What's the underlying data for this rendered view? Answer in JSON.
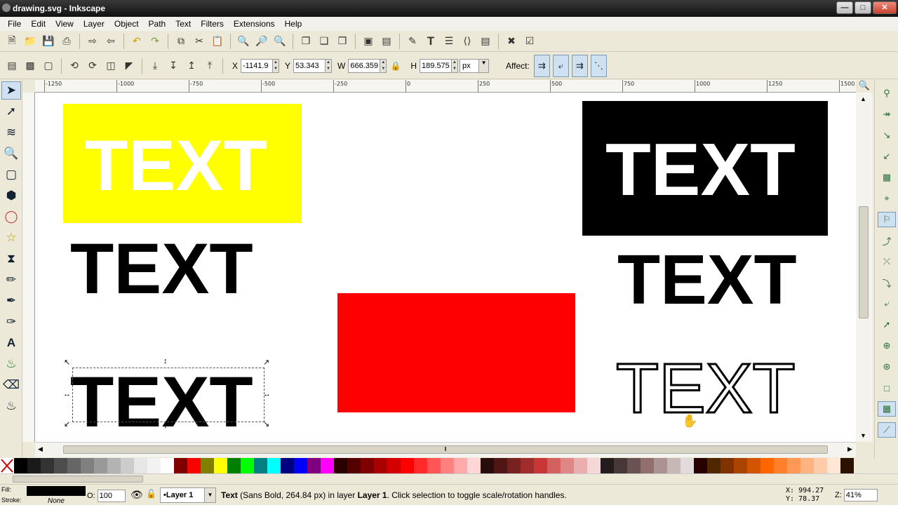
{
  "window": {
    "title": "drawing.svg - Inkscape"
  },
  "menus": [
    "File",
    "Edit",
    "View",
    "Layer",
    "Object",
    "Path",
    "Text",
    "Filters",
    "Extensions",
    "Help"
  ],
  "controls": {
    "x_label": "X",
    "x_value": "-1141.9",
    "y_label": "Y",
    "y_value": "53.343",
    "w_label": "W",
    "w_value": "666.359",
    "h_label": "H",
    "h_value": "189.575",
    "unit": "px",
    "affect_label": "Affect:"
  },
  "ruler": {
    "labels": [
      "-1250",
      "-1000",
      "-750",
      "-500",
      "-250",
      "0",
      "250",
      "500",
      "750",
      "1000",
      "1250",
      "1500"
    ]
  },
  "canvas": {
    "text_yellow": "TEXT",
    "text_black_plain": "TEXT",
    "text_selected": "TEXT",
    "text_on_black": "TEXT",
    "text_black_right": "TEXT",
    "text_outline": "TEXT",
    "colors": {
      "yellow": "#ffff00",
      "red": "#ff0000",
      "black": "#000000",
      "white": "#ffffff"
    }
  },
  "palette": [
    "#000000",
    "#1a1a1a",
    "#333333",
    "#4d4d4d",
    "#666666",
    "#808080",
    "#999999",
    "#b3b3b3",
    "#cccccc",
    "#e6e6e6",
    "#f2f2f2",
    "#ffffff",
    "#800000",
    "#ff0000",
    "#808000",
    "#ffff00",
    "#008000",
    "#00ff00",
    "#008080",
    "#00ffff",
    "#000080",
    "#0000ff",
    "#800080",
    "#ff00ff",
    "#2b0000",
    "#550000",
    "#800000",
    "#aa0000",
    "#d40000",
    "#ff0000",
    "#ff2a2a",
    "#ff5555",
    "#ff8080",
    "#ffaaaa",
    "#ffd5d5",
    "#280b0b",
    "#501616",
    "#782121",
    "#a02c2c",
    "#c83737",
    "#d35f5f",
    "#de8787",
    "#e9afaf",
    "#f4d7d7",
    "#241c1c",
    "#483737",
    "#6c5353",
    "#916f6f",
    "#ac9393",
    "#c8b7b7",
    "#e3dbdb",
    "#280000",
    "#502800",
    "#803300",
    "#aa4400",
    "#d45500",
    "#ff6600",
    "#ff7f2a",
    "#ff9955",
    "#ffb380",
    "#ffccaa",
    "#ffe6d5",
    "#2b1100"
  ],
  "status": {
    "fill_label": "Fill:",
    "stroke_label": "Stroke:",
    "stroke_value": "None",
    "opacity_label": "O:",
    "opacity_value": "100",
    "layer": "•Layer 1",
    "message_type": "Text",
    "message_rest": " (Sans Bold, 264.84 px) in layer ",
    "message_layer": "Layer 1",
    "message_tail": ". Click selection to toggle scale/rotation handles.",
    "coord_x_label": "X:",
    "coord_x": "994.27",
    "coord_y_label": "Y:",
    "coord_y": "78.37",
    "zoom_label": "Z:",
    "zoom_value": "41%"
  }
}
